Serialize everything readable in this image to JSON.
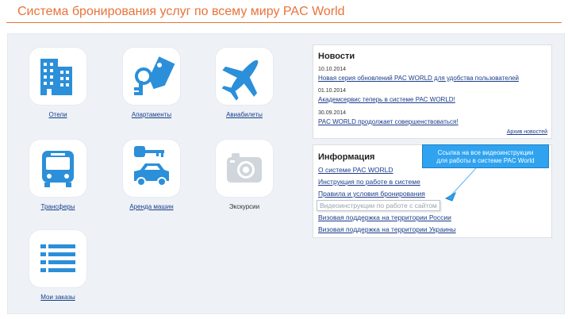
{
  "header": {
    "title": "Система бронирования услуг по всему миру PAC World"
  },
  "tiles": {
    "hotels": "Отели",
    "apartments": "Апартаменты",
    "flights": "Авиабилеты",
    "transfers": "Трансферы",
    "car_rental": "Аренда машин",
    "excursions": "Экскурсии",
    "my_orders": "Мои заказы"
  },
  "icons": {
    "hotels": "building-icon",
    "apartments": "key-tag-icon",
    "flights": "airplane-icon",
    "transfers": "bus-icon",
    "car_rental": "car-key-icon",
    "excursions": "camera-icon",
    "my_orders": "list-icon"
  },
  "news": {
    "title": "Новости",
    "items": [
      {
        "date": "10.10.2014",
        "text": "Новая серия обновлений PAC WORLD для удобства пользователей"
      },
      {
        "date": "01.10.2014",
        "text": "Академсервис теперь в системе PAC WORLD!"
      },
      {
        "date": "30.09.2014",
        "text": "PAC WORLD продолжает совершенствоваться!"
      }
    ],
    "archive": "Архив новостей"
  },
  "info": {
    "title": "Информация",
    "links": [
      "О системе PAC WORLD",
      "Инструкция по работе в системе",
      "Правила и условия бронирования",
      "Видеоинструкции по работе с сайтом",
      "Визовая поддержка на территории России",
      "Визовая поддержка на территории Украины"
    ]
  },
  "tooltip": {
    "line1": "Ссылка на все видеоинструкции",
    "line2": "для работы в системе PAC World"
  },
  "colors": {
    "accent": "#e8733a",
    "icon_blue": "#2b8fd9",
    "link": "#1a3d8a",
    "tooltip_bg": "#2fa3f0",
    "panel_bg": "#eef2f6",
    "disabled_icon": "#d0d6dc"
  }
}
